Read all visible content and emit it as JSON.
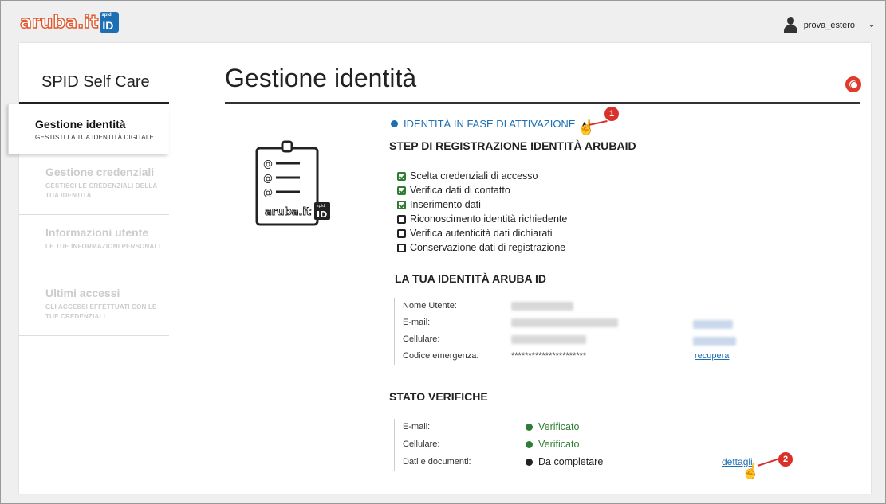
{
  "header": {
    "logo_text": "aruba.it",
    "logo_badge_top": "spid",
    "logo_badge_main": "ID",
    "username": "prova_estero"
  },
  "sidebar": {
    "title": "SPID Self Care",
    "items": [
      {
        "label": "Gestione identità",
        "subtitle": "GESTISTI LA TUA IDENTITÀ DIGITALE",
        "active": true
      },
      {
        "label": "Gestione credenziali",
        "subtitle": "GESTISCI LE CREDENZIALI DELLA TUA IDENTITÀ",
        "active": false
      },
      {
        "label": "Informazioni utente",
        "subtitle": "LE TUE INFORMAZIONI PERSONALI",
        "active": false
      },
      {
        "label": "Ultimi accessi",
        "subtitle": "GLI ACCESSI EFFETTUATI CON LE TUE CREDENZIALI",
        "active": false
      }
    ]
  },
  "main": {
    "title": "Gestione identità",
    "status": {
      "label": "IDENTITÀ IN FASE DI ATTIVAZIONE",
      "color": "#1d6fb4"
    },
    "callouts": [
      "1",
      "2"
    ],
    "illustration_logo": "aruba.it",
    "illustration_badge_top": "spid",
    "illustration_badge_main": "ID",
    "steps_heading": "STEP DI REGISTRAZIONE IDENTITÀ ARUBAID",
    "steps": [
      {
        "label": "Scelta credenziali di accesso",
        "done": true
      },
      {
        "label": "Verifica dati di contatto",
        "done": true
      },
      {
        "label": "Inserimento dati",
        "done": true
      },
      {
        "label": "Riconoscimento identità richiedente",
        "done": false
      },
      {
        "label": "Verifica autenticità dati dichiarati",
        "done": false
      },
      {
        "label": "Conservazione dati di registrazione",
        "done": false
      }
    ],
    "identity_heading": "LA TUA IDENTITÀ ARUBA ID",
    "identity": [
      {
        "key": "Nome Utente:",
        "value": ""
      },
      {
        "key": "E-mail:",
        "value": ""
      },
      {
        "key": "Cellulare:",
        "value": ""
      },
      {
        "key": "Codice emergenza:",
        "value": "**********************",
        "action": "recupera"
      }
    ],
    "verify_heading": "STATO VERIFICHE",
    "verifications": [
      {
        "key": "E-mail:",
        "status": "Verificato",
        "color": "#2e7d32"
      },
      {
        "key": "Cellulare:",
        "status": "Verificato",
        "color": "#2e7d32"
      },
      {
        "key": "Dati e documenti:",
        "status": "Da completare",
        "color": "#222222",
        "action": "dettagli"
      }
    ]
  }
}
